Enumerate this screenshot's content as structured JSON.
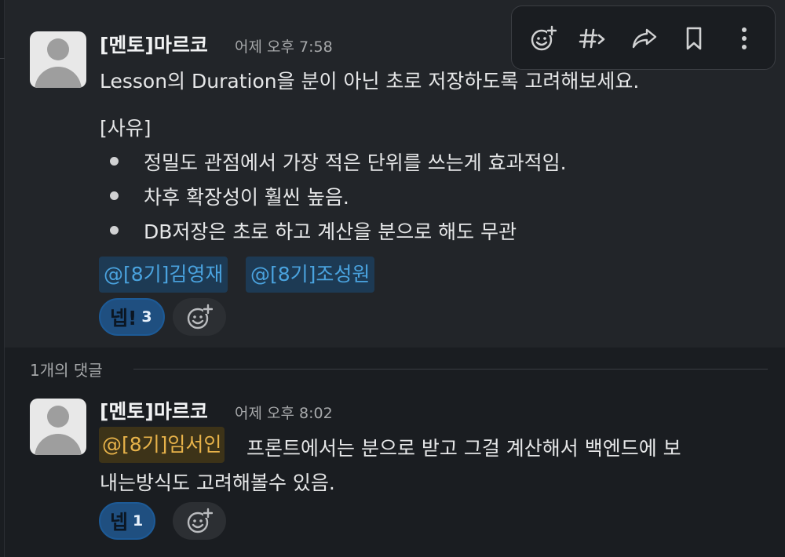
{
  "toolbar": {
    "icons": [
      "add-reaction-icon",
      "hashtag-forward-icon",
      "share-icon",
      "bookmark-icon",
      "more-vertical-icon"
    ]
  },
  "parent_message": {
    "author": "[멘토]마르코",
    "time": "어제 오후 7:58",
    "line1": "Lesson의 Duration을 분이 아닌 초로 저장하도록 고려해보세요.",
    "reason_header": "[사유]",
    "bullets": [
      "정밀도 관점에서 가장 적은 단위를 쓰는게 효과적임.",
      "차후 확장성이 훨씬 높음.",
      "DB저장은 초로 하고 계산을 분으로 해도 무관"
    ],
    "mentions": [
      "@[8기]김영재",
      "@[8기]조성원"
    ],
    "reaction": {
      "emoji": "넵!",
      "count": "3"
    }
  },
  "thread_divider": {
    "label": "1개의 댓글"
  },
  "reply_message": {
    "author": "[멘토]마르코",
    "time": "어제 오후 8:02",
    "mention": "@[8기]임서인",
    "line1_rest": "프론트에서는 분으로 받고 그걸 계산해서 백엔드에 보",
    "line2": "내는방식도 고려해볼수 있음.",
    "reaction": {
      "emoji": "넵",
      "count": "1"
    }
  },
  "colors": {
    "background": "#1a1d21",
    "hover_background": "#222529",
    "mention_bg": "#1d3a54",
    "mention_text": "#4aa3df",
    "self_mention_bg": "#3d3318",
    "self_mention_text": "#e8b34a",
    "reaction_bg": "#1f4f80"
  }
}
